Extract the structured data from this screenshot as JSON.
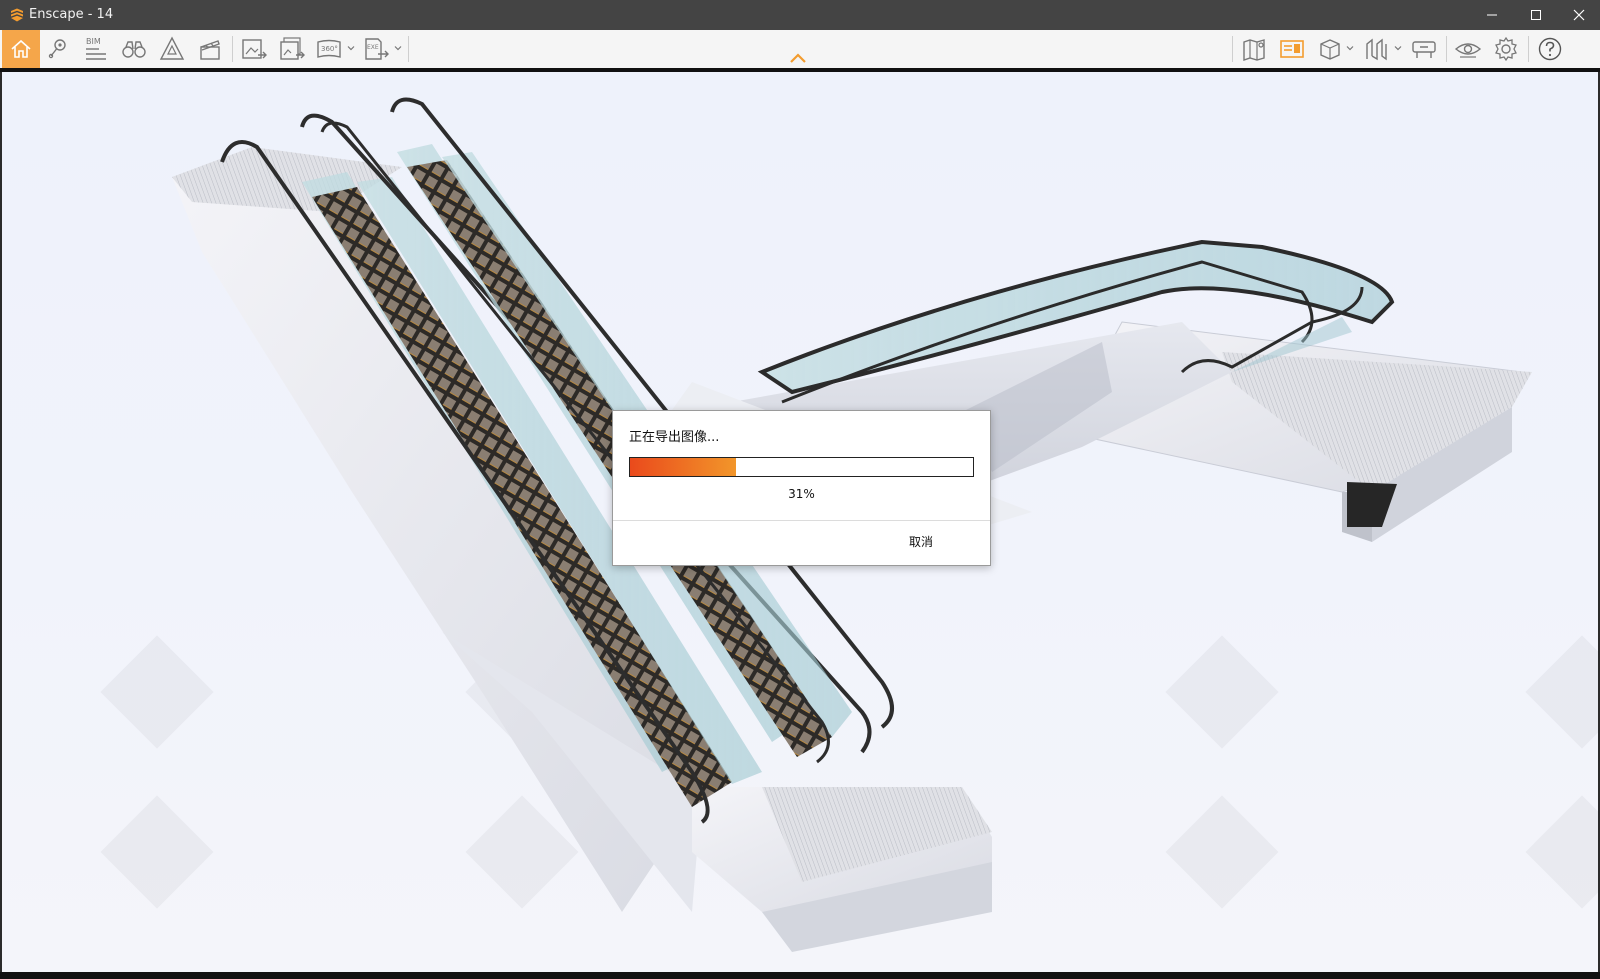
{
  "window": {
    "title": "Enscape - 14",
    "accent_color": "#f39c2f"
  },
  "toolbar": {
    "left_icons": [
      "home-icon",
      "location-pin-icon",
      "bim-icon",
      "binoculars-icon",
      "perspective-icon",
      "video-clapper-icon",
      "screenshot-export-icon",
      "batch-export-icon",
      "panorama-360-icon",
      "exe-export-icon"
    ],
    "right_icons": [
      "map-icon",
      "visual-settings-icon",
      "view-box-icon",
      "sections-icon",
      "asset-library-icon",
      "eye-icon",
      "settings-gear-icon",
      "help-icon"
    ],
    "bim_label": "BIM",
    "pano_label": "360°",
    "exe_label": "EXE"
  },
  "dialog": {
    "message": "正在导出图像...",
    "progress_percent": 31,
    "progress_text": "31%",
    "cancel_label": "取消"
  }
}
